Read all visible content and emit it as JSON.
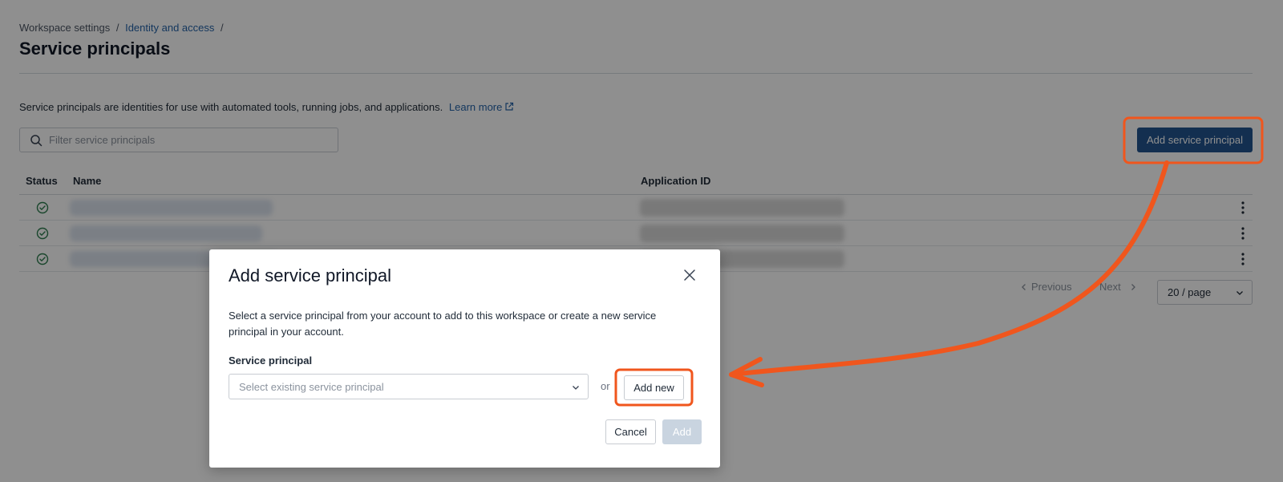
{
  "breadcrumb": {
    "root": "Workspace settings",
    "parent": "Identity and access",
    "separator": "/"
  },
  "page": {
    "title": "Service principals",
    "description": "Service principals are identities for use with automated tools, running jobs, and applications.",
    "learn_more": "Learn more"
  },
  "search": {
    "placeholder": "Filter service principals"
  },
  "toolbar": {
    "add_button_label": "Add service principal"
  },
  "table": {
    "columns": {
      "status": "Status",
      "name": "Name",
      "application_id": "Application ID"
    },
    "rows": [
      {
        "status": "active"
      },
      {
        "status": "active"
      },
      {
        "status": "active"
      }
    ]
  },
  "pagination": {
    "previous": "Previous",
    "next": "Next",
    "page_size": "20 / page"
  },
  "modal": {
    "title": "Add service principal",
    "description": "Select a service principal from your account to add to this workspace or create a new service principal in your account.",
    "field_label": "Service principal",
    "select_placeholder": "Select existing service principal",
    "or_text": "or",
    "add_new_label": "Add new",
    "cancel_label": "Cancel",
    "add_label": "Add"
  },
  "colors": {
    "primary": "#22558f",
    "link": "#2563a8",
    "success": "#2e7d4f",
    "annotation": "#f0561d"
  },
  "icons": {
    "search": "search-icon",
    "external": "external-link-icon",
    "status": "check-circle-icon",
    "menu": "kebab-icon",
    "close": "close-icon",
    "dropdown": "chevron-down-icon"
  }
}
